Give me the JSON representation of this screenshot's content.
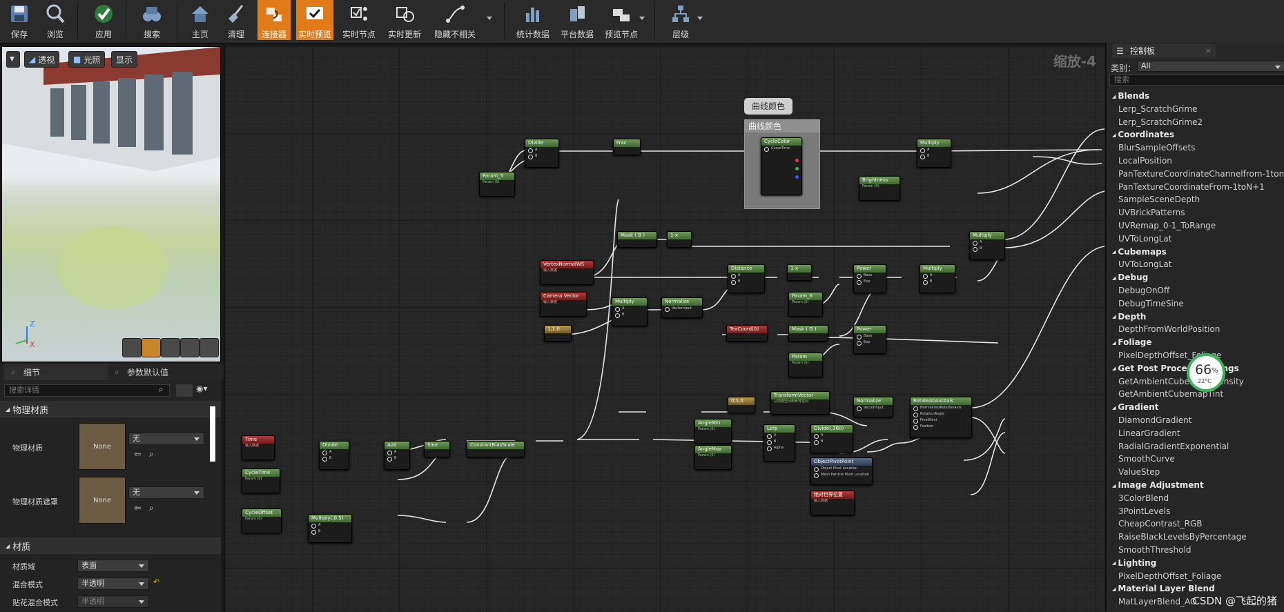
{
  "toolbar": {
    "buttons": [
      {
        "label": "保存",
        "icon": "save-icon"
      },
      {
        "label": "浏览",
        "icon": "browse-icon"
      },
      {
        "label": "应用",
        "icon": "apply-checkmark-icon"
      },
      {
        "label": "搜索",
        "icon": "search-binoculars-icon"
      },
      {
        "label": "主页",
        "icon": "home-icon"
      },
      {
        "label": "清理",
        "icon": "clean-broom-icon"
      },
      {
        "label": "连接器",
        "icon": "connectors-icon"
      },
      {
        "label": "实时预览",
        "icon": "live-preview-icon"
      },
      {
        "label": "实时节点",
        "icon": "live-nodes-icon"
      },
      {
        "label": "实时更新",
        "icon": "live-update-icon"
      },
      {
        "label": "隐藏不相关",
        "icon": "hide-unrelated-icon"
      },
      {
        "label": "统计数据",
        "icon": "stats-icon"
      },
      {
        "label": "平台数据",
        "icon": "platform-stats-icon"
      },
      {
        "label": "预览节点",
        "icon": "preview-node-icon"
      },
      {
        "label": "层级",
        "icon": "hierarchy-icon"
      }
    ]
  },
  "viewport": {
    "perspective": "透视",
    "lit": "光照",
    "show": "显示",
    "axis_z": "Z",
    "axis_x": "X"
  },
  "left_panel": {
    "tab_details": "细节",
    "tab_params": "参数默认值",
    "search_placeholder": "搜索详情",
    "section_physmat": "物理材质",
    "physmat_label": "物理材质",
    "physmat_mask_label": "物理材质遮罩",
    "none": "None",
    "combo_none": "无",
    "section_material": "材质",
    "domain_label": "材质域",
    "domain_value": "表面",
    "blend_label": "混合模式",
    "blend_value": "半透明",
    "decal_label": "贴花混合模式",
    "decal_value": "半透明"
  },
  "graph": {
    "zoom": "缩放-4",
    "comment_bubble": "曲线颜色",
    "comment_title": "曲线颜色",
    "nodes": {
      "divide1": "Divide",
      "frac": "Frac",
      "param5": "Param_5",
      "param_sub": "Param (0)",
      "cyclecolor": "CycleColor",
      "curvetime": "CurveTime",
      "multiply_top": "Multiply",
      "brightness": "Brightness",
      "mask_b": "Mask ( B )",
      "oneminus1": "1-x",
      "vertexnormal": "VertexNormalWS",
      "input_data": "输入数据",
      "multiply_r1": "Multiply",
      "distance": "Distance",
      "oneminus2": "1-x",
      "power1": "Power",
      "multiply_r2": "Multiply",
      "param6": "Param_6",
      "camvec": "Camera Vector",
      "multiply_c": "Multiply",
      "normalize1": "Normalize",
      "vectorinput": "VectorInput",
      "const110": "1,1,0",
      "texcoord": "TexCoord[0]",
      "mask_g": "Mask ( G )",
      "power2": "Power",
      "param": "Param",
      "const010": "0,1,0",
      "transform": "TransformVector",
      "transform_sub": "从局部空间到世界空间",
      "normalize2": "Normalize",
      "rotate": "RotateAboutAxis",
      "rot_pin1": "NormalizedRotationAxis",
      "rot_pin2": "RotationAngle",
      "rot_pin3": "PivotPoint",
      "rot_pin4": "Position",
      "anglemin": "AngleMin",
      "anglemax": "AngleMax",
      "lerp": "Lerp",
      "divide360": "Divide(,360)",
      "objpivot": "ObjectPivotPoint",
      "objpivot_pin1": "Object Pivot Location",
      "objpivot_pin2": "Mesh Particle Pivot Location",
      "abspos": "绝对世界位置",
      "time": "Time",
      "divide2": "Divide",
      "add": "Add",
      "sine": "Sine",
      "cbs": "ConstantBiasScale",
      "cycletime": "CycleTime",
      "cycleoffset": "CycleOffset",
      "multiply05": "Multiply(,0.5)",
      "pin_a": "A",
      "pin_b": "B",
      "pin_alpha": "Alpha",
      "pin_base": "Base",
      "pin_exp": "Exp"
    }
  },
  "control_panel": {
    "title": "控制板",
    "category_label": "类别：",
    "category_value": "All",
    "search_placeholder": "搜索",
    "list": [
      {
        "type": "cat",
        "text": "Blends"
      },
      {
        "type": "item",
        "text": "Lerp_ScratchGrime"
      },
      {
        "type": "item",
        "text": "Lerp_ScratchGrime2"
      },
      {
        "type": "cat",
        "text": "Coordinates"
      },
      {
        "type": "item",
        "text": "BlurSampleOffsets"
      },
      {
        "type": "item",
        "text": "LocalPosition"
      },
      {
        "type": "item",
        "text": "PanTextureCoordinateChannelfrom-1ton+1"
      },
      {
        "type": "item",
        "text": "PanTextureCoordinateFrom-1toN+1"
      },
      {
        "type": "item",
        "text": "SampleSceneDepth"
      },
      {
        "type": "item",
        "text": "UVBrickPatterns"
      },
      {
        "type": "item",
        "text": "UVRemap_0-1_ToRange"
      },
      {
        "type": "item",
        "text": "UVToLongLat"
      },
      {
        "type": "cat",
        "text": "Cubemaps"
      },
      {
        "type": "item",
        "text": "UVToLongLat"
      },
      {
        "type": "cat",
        "text": "Debug"
      },
      {
        "type": "item",
        "text": "DebugOnOff"
      },
      {
        "type": "item",
        "text": "DebugTimeSine"
      },
      {
        "type": "cat",
        "text": "Depth"
      },
      {
        "type": "item",
        "text": "DepthFromWorldPosition"
      },
      {
        "type": "cat",
        "text": "Foliage"
      },
      {
        "type": "item",
        "text": "PixelDepthOffset_Foliage"
      },
      {
        "type": "cat",
        "text": "Get Post Process Settings"
      },
      {
        "type": "item",
        "text": "GetAmbientCubemapIntensity"
      },
      {
        "type": "item",
        "text": "GetAmbientCubemapTint"
      },
      {
        "type": "cat",
        "text": "Gradient"
      },
      {
        "type": "item",
        "text": "DiamondGradient"
      },
      {
        "type": "item",
        "text": "LinearGradient"
      },
      {
        "type": "item",
        "text": "RadialGradientExponential"
      },
      {
        "type": "item",
        "text": "SmoothCurve"
      },
      {
        "type": "item",
        "text": "ValueStep"
      },
      {
        "type": "cat",
        "text": "Image Adjustment"
      },
      {
        "type": "item",
        "text": "3ColorBlend"
      },
      {
        "type": "item",
        "text": "3PointLevels"
      },
      {
        "type": "item",
        "text": "CheapContrast_RGB"
      },
      {
        "type": "item",
        "text": "RaiseBlackLevelsByPercentage"
      },
      {
        "type": "item",
        "text": "SmoothThreshold"
      },
      {
        "type": "cat",
        "text": "Lighting"
      },
      {
        "type": "item",
        "text": "PixelDepthOffset_Foliage"
      },
      {
        "type": "cat",
        "text": "Material Layer Blend"
      },
      {
        "type": "item",
        "text": "MatLayerBlend_AO"
      }
    ]
  },
  "overlay": {
    "badge_percent": "66",
    "badge_unit": "%",
    "badge_temp": "22°C",
    "watermark": "CSDN @飞起的猪"
  },
  "colors": {
    "accent": "#e07b18",
    "badge_ring": "#3bb55a"
  }
}
